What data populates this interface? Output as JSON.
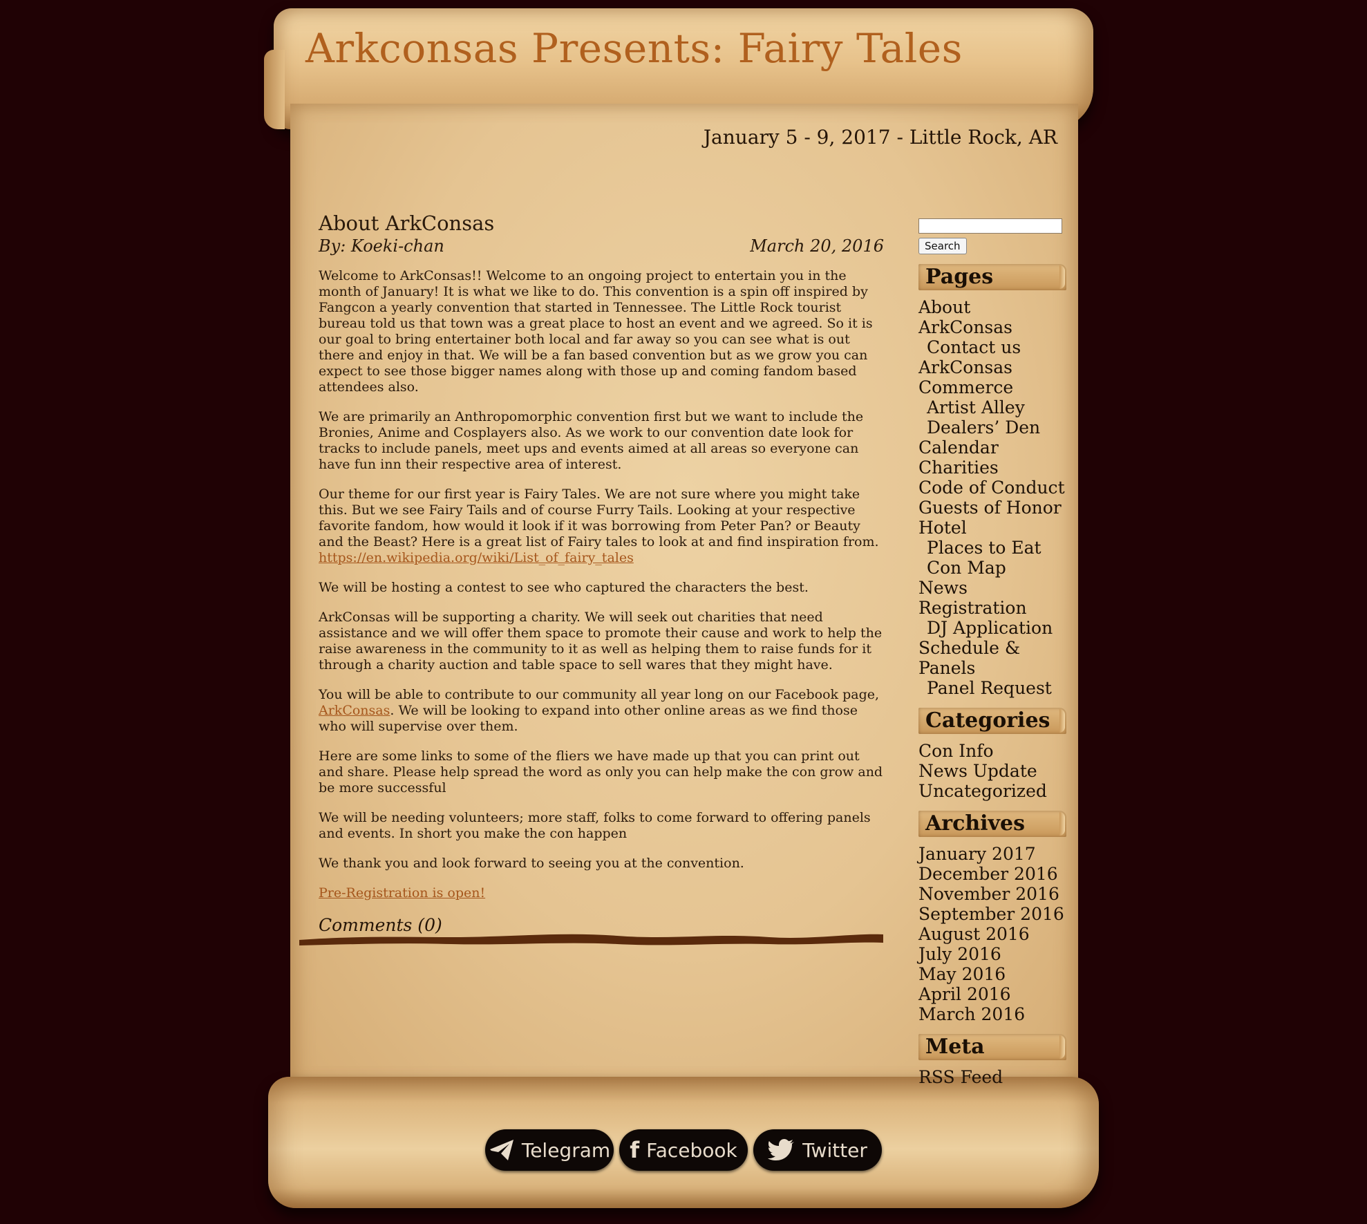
{
  "header": {
    "title": "Arkconsas Presents: Fairy Tales",
    "subtitle": "January 5 - 9, 2017 - Little Rock, AR"
  },
  "post": {
    "title": "About ArkConsas",
    "author": "By: Koeki-chan",
    "date": "March 20, 2016",
    "paragraphs": {
      "p1": "Welcome to ArkConsas!!  Welcome to an ongoing project to entertain you in the month of January!  It is what we like to do.  This convention is a spin off inspired by Fangcon a yearly convention that started in Tennessee.  The Little Rock tourist bureau told us that town was a great place to host an event and we agreed.  So it is our goal to bring entertainer both local and far away so you can see what is out there and enjoy in that.  We will be a fan based convention but as we grow you can expect to see those bigger names along with those up and coming fandom based attendees also.",
      "p2": "We are primarily an Anthropomorphic convention first but we want to include the Bronies, Anime and Cosplayers also.  As we work to our convention date look for tracks to include panels, meet ups and events aimed at all areas so everyone can have fun inn their respective area of interest.",
      "p3": "Our theme for our first year is Fairy Tales.  We are not sure where you might take this.  But we see Fairy Tails and of course Furry Tails. Looking at your respective favorite fandom, how would it look if it was borrowing from Peter Pan? or Beauty and the Beast? Here is a great list of Fairy tales to look at and find inspiration from.",
      "p3_link": "https://en.wikipedia.org/wiki/List_of_fairy_tales",
      "p4": "We will be hosting a contest to see who captured the characters the best.",
      "p5": "ArkConsas will be supporting a charity. We will seek out charities that need assistance and we will offer them space to promote their cause and work to help the raise awareness in the community to it as well as helping them to raise funds for it through a charity auction and table space to sell wares that they might have.",
      "p6_before": "You will be able to contribute to our community all year long on our Facebook page, ",
      "p6_link": "ArkConsas",
      "p6_after": ".  We will be looking to expand into other online areas as we find those who will supervise over them.",
      "p7": "Here are some links to some of the fliers we have made up that you can print out and share.  Please help spread the word as only you can help make the con grow and be more successful",
      "p8": "We will be needing volunteers; more staff, folks to come forward to offering panels and events. In short you make the con happen",
      "p9": "We thank you and look forward to seeing you at the convention.",
      "prereg_link": "Pre-Registration is open!"
    },
    "comments": "Comments (0)"
  },
  "sidebar": {
    "search_value": "",
    "search_button": "Search",
    "pages_title": "Pages",
    "pages": [
      {
        "label": "About ArkConsas",
        "sub": false
      },
      {
        "label": "Contact us",
        "sub": true
      },
      {
        "label": "ArkConsas",
        "sub": false
      },
      {
        "label": "Commerce",
        "sub": false
      },
      {
        "label": "Artist Alley",
        "sub": true
      },
      {
        "label": "Dealers’ Den",
        "sub": true
      },
      {
        "label": "Calendar",
        "sub": false
      },
      {
        "label": "Charities",
        "sub": false
      },
      {
        "label": "Code of Conduct",
        "sub": false
      },
      {
        "label": "Guests of Honor",
        "sub": false
      },
      {
        "label": "Hotel",
        "sub": false
      },
      {
        "label": "Places to Eat",
        "sub": true
      },
      {
        "label": "Con Map",
        "sub": true
      },
      {
        "label": "News",
        "sub": false
      },
      {
        "label": "Registration",
        "sub": false
      },
      {
        "label": "DJ Application",
        "sub": true
      },
      {
        "label": "Schedule & Panels",
        "sub": false
      },
      {
        "label": "Panel Request",
        "sub": true
      }
    ],
    "categories_title": "Categories",
    "categories": [
      "Con Info",
      "News Update",
      "Uncategorized"
    ],
    "archives_title": "Archives",
    "archives": [
      "January 2017",
      "December 2016",
      "November 2016",
      "September 2016",
      "August 2016",
      "July 2016",
      "May 2016",
      "April 2016",
      "March 2016"
    ],
    "meta_title": "Meta",
    "meta": [
      "RSS Feed"
    ]
  },
  "social": {
    "telegram": "Telegram",
    "facebook": "Facebook",
    "twitter": "Twitter"
  },
  "colors": {
    "background": "#200205",
    "title": "#b0601e",
    "link": "#a5561c",
    "divider": "#5a2a0c"
  }
}
